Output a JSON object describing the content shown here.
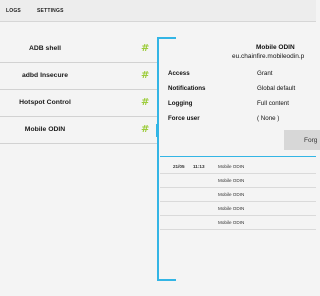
{
  "tabs": {
    "logs": "LOGS",
    "settings": "SETTINGS"
  },
  "apps": [
    {
      "label": "ADB shell"
    },
    {
      "label": "adbd Insecure"
    },
    {
      "label": "Hotspot Control"
    },
    {
      "label": "Mobile ODIN"
    }
  ],
  "app_icon_glyph": "#",
  "selected_app": "Mobile ODIN",
  "details": {
    "title": "Mobile ODIN",
    "package": "eu.chainfire.mobileodin.p",
    "access_label": "Access",
    "access_value": "Grant",
    "notifications_label": "Notifications",
    "notifications_value": "Global default",
    "logging_label": "Logging",
    "logging_value": "Full content",
    "force_user_label": "Force user",
    "force_user_value": "( None )",
    "forget_label": "Forg"
  },
  "logs": [
    {
      "date": "21/05",
      "time": "11:13",
      "name": "Mobile ODIN"
    },
    {
      "date": "",
      "time": "",
      "name": "Mobile ODIN"
    },
    {
      "date": "",
      "time": "",
      "name": "Mobile ODIN"
    },
    {
      "date": "",
      "time": "",
      "name": "Mobile ODIN"
    },
    {
      "date": "",
      "time": "",
      "name": "Mobile ODIN"
    }
  ],
  "colors": {
    "accent": "#33b5e5",
    "app_icon": "#9ccc3a",
    "background": "#f4f4f4",
    "button": "#d7d7d7"
  }
}
